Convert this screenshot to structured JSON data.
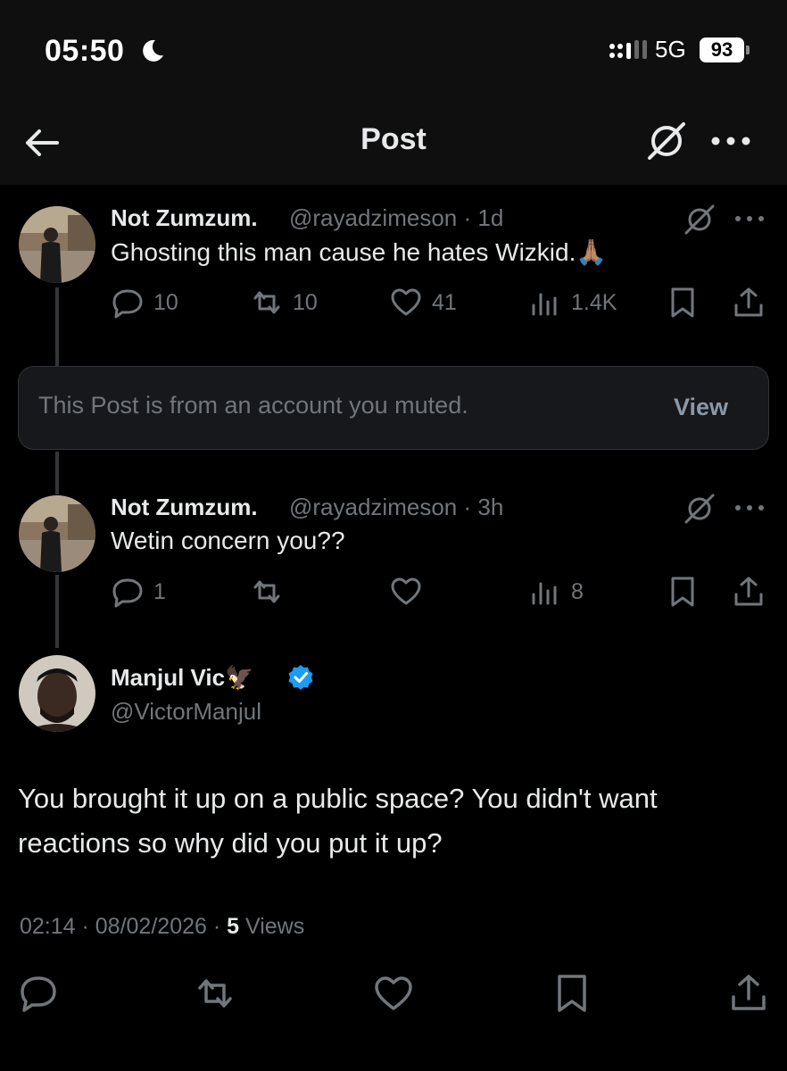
{
  "status_bar": {
    "time": "05:50",
    "network": "5G",
    "battery": "93"
  },
  "header": {
    "title": "Post"
  },
  "posts": [
    {
      "name": "Not Zumzum.",
      "handle": "@rayadzimeson",
      "time": "· 1d",
      "text": "Ghosting this man cause he hates Wizkid.🙏🏽",
      "replies": "10",
      "reposts": "10",
      "likes": "41",
      "views": "1.4K"
    },
    {
      "name": "Not Zumzum.",
      "handle": "@rayadzimeson",
      "time": "· 3h",
      "text": "Wetin concern you??",
      "replies": "1",
      "reposts": "",
      "likes": "",
      "views": "8"
    }
  ],
  "muted_notice": {
    "text": "This Post is from an account you muted.",
    "action": "View"
  },
  "main_post": {
    "name": "Manjul Vic🦅",
    "handle": "@VictorManjul",
    "text": "You brought it up on a public space? You didn't want reactions so why did you put it up?",
    "timestamp": "02:14 · 08/02/2026 · ",
    "views_count": "5",
    "views_label": " Views"
  },
  "colors": {
    "background": "#000000",
    "muted_text": "#71767b",
    "verified_blue": "#1d9bf0"
  }
}
